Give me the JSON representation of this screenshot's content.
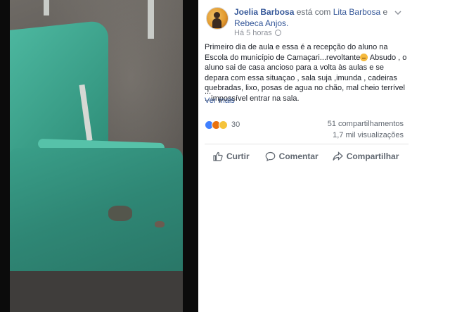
{
  "post": {
    "author": "Joelia Barbosa",
    "with_text": "está com",
    "tag_1": "Lita Barbosa",
    "and_text": "e",
    "tag_2": "Rebeca Anjos.",
    "time": "Há 5 horas",
    "caption_before_emoji": "Primeiro dia de aula e essa é a recepção do aluno na Escola do município de Camaçari...revoltante",
    "caption_after_emoji": " Absudo , o aluno sai de casa ancioso para a volta às aulas e se depara com essa situaçao , sala suja ,imunda , cadeiras quebradas, lixo, posas de agua no chão, mal cheio terrível ...impossível entrar na sala.",
    "ellipsis": "...",
    "see_more": "Ver mais"
  },
  "stats": {
    "reactions_count": "30",
    "shares": "51 compartilhamentos",
    "views": "1,7 mil visualizações"
  },
  "actions": {
    "like": "Curtir",
    "comment": "Comentar",
    "share": "Compartilhar"
  },
  "icons": {
    "reactions": [
      "like-reaction-icon",
      "angry-reaction-icon",
      "wow-reaction-icon"
    ],
    "caption_emoji": "angry-face-emoji-icon",
    "menu": "chevron-down-icon",
    "privacy": "globe-icon"
  },
  "colors": {
    "link": "#365899",
    "meta": "#90949c",
    "text": "#1d2129",
    "action": "#606770"
  }
}
